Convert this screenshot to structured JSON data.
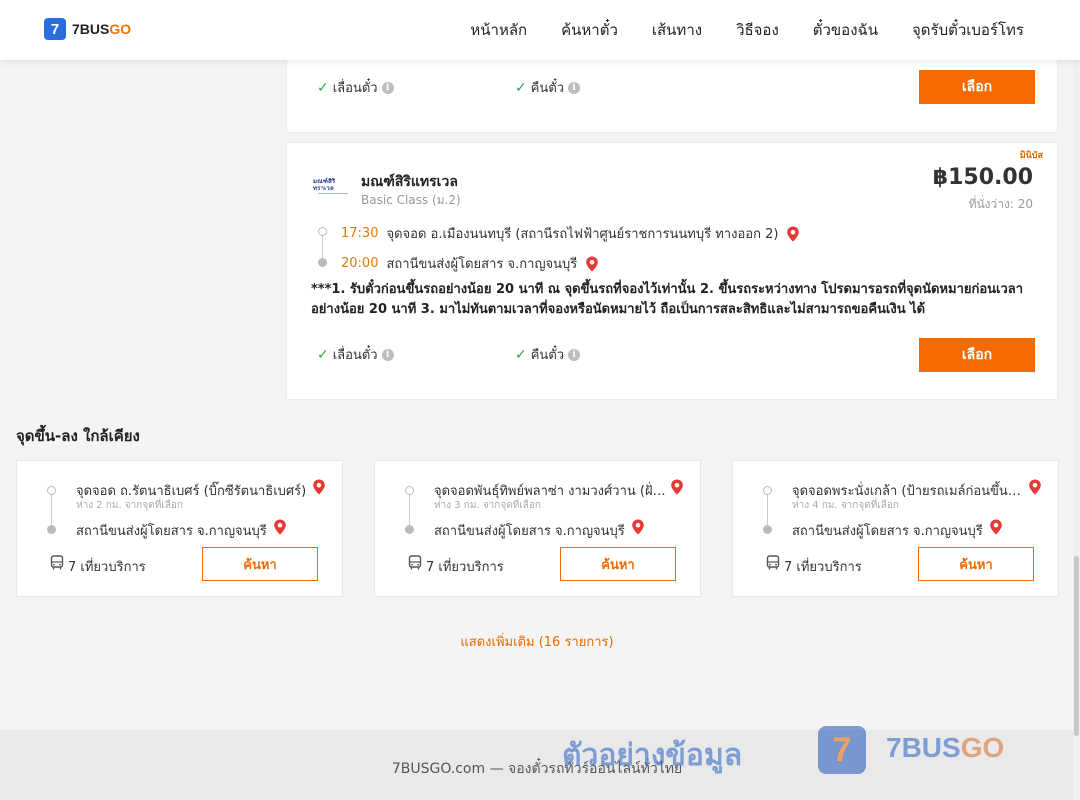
{
  "header": {
    "logo_number": "7",
    "logo_brand_a": "7BUS",
    "logo_brand_b": "GO",
    "nav": [
      "หน้าหลัก",
      "ค้นหาตั๋ว",
      "เส้นทาง",
      "วิธีจอง",
      "ตั๋วของฉัน",
      "จุดรับตั๋วเบอร์โทร"
    ]
  },
  "card1": {
    "feature_change": "เลื่อนตั๋ว",
    "feature_refund": "คืนตั๋ว",
    "select_label": "เลือก"
  },
  "card2": {
    "operator_logo_text": "มณฑ์สิริ ทราเวล",
    "operator": "มณฑ์สิริแทรเวล",
    "bus_class": "Basic Class (ม.2)",
    "badge": "มินิบัส",
    "price": "฿150.00",
    "seats": "ที่นั่งว่าง: 20",
    "depart_time": "17:30",
    "depart_stop": "จุดจอด อ.เมืองนนทบุรี (สถานีรถไฟฟ้าศูนย์ราชการนนทบุรี ทางออก 2)",
    "arrive_time": "20:00",
    "arrive_stop": "สถานีขนส่งผู้โดยสาร จ.กาญจนบุรี",
    "notes": "***1. รับตั๋วก่อนขึ้นรถอย่างน้อย 20 นาที ณ จุดขึ้นรถที่จองไว้เท่านั้น 2. ขึ้นรถระหว่างทาง โปรดมารอรถที่จุดนัดหมายก่อนเวลาอย่างน้อย 20 นาที 3. มาไม่ทันตามเวลาที่จองหรือนัดหมายไว้ ถือเป็นการสละสิทธิและไม่สามารถขอคืนเงิน ได้",
    "feature_change": "เลื่อนตั๋ว",
    "feature_refund": "คืนตั๋ว",
    "select_label": "เลือก"
  },
  "nearby": {
    "title": "จุดขึ้น-ลง ใกล้เคียง",
    "items": [
      {
        "from": "จุดจอด ถ.รัตนาธิเบศร์ (บิ๊กซีรัตนาธิเบศร์)",
        "distance": "ห่าง 2 กม. จากจุดที่เลือก",
        "to": "สถานีขนส่งผู้โดยสาร จ.กาญจนบุรี",
        "trips": "7 เที่ยวบริการ",
        "button": "ค้นหา"
      },
      {
        "from": "จุดจอดพันธุ์ทิพย์พลาซ่า งามวงศ์วาน (ฝั่งขาออก)",
        "distance": "ห่าง 3 กม. จากจุดที่เลือก",
        "to": "สถานีขนส่งผู้โดยสาร จ.กาญจนบุรี",
        "trips": "7 เที่ยวบริการ",
        "button": "ค้นหา"
      },
      {
        "from": "จุดจอดพระนั่งเกล้า (ป้ายรถเมล์ก่อนขึ้นสะพาน)",
        "distance": "ห่าง 4 กม. จากจุดที่เลือก",
        "to": "สถานีขนส่งผู้โดยสาร จ.กาญจนบุรี",
        "trips": "7 เที่ยวบริการ",
        "button": "ค้นหา"
      }
    ],
    "show_more": "แสดงเพิ่มเติม (16 รายการ)"
  },
  "footer": {
    "text": "7BUSGO.com — จองตั๋วรถทัวร์ออนไลน์ทั่วไทย",
    "watermark_text": "ตัวอย่างข้อมูล",
    "watermark_logo": "7",
    "watermark_brand_a": "7BUS",
    "watermark_brand_b": "GO"
  },
  "colors": {
    "accent": "#f56a00",
    "brand_blue": "#2b6de0",
    "check_green": "#2aa64f",
    "pin_red": "#e53935"
  }
}
